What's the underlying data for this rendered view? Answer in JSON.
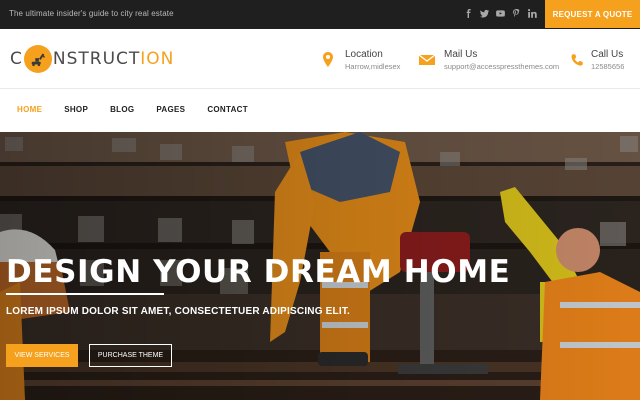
{
  "topbar": {
    "tagline": "The ultimate insider's guide to city real estate",
    "social_icons": [
      "facebook-icon",
      "twitter-icon",
      "youtube-icon",
      "pinterest-icon",
      "linkedin-icon"
    ],
    "cta_label": "REQUEST A QUOTE"
  },
  "header": {
    "logo": {
      "prefix": "C",
      "middle": "NSTRUCT",
      "accent": "ION"
    },
    "location": {
      "label": "Location",
      "value": "Harrow,midlesex"
    },
    "mail": {
      "label": "Mail Us",
      "value": "support@accesspressthemes.com"
    },
    "call": {
      "label": "Call Us",
      "value": "12585656"
    }
  },
  "nav": {
    "items": [
      {
        "label": "HOME",
        "active": true
      },
      {
        "label": "SHOP",
        "active": false
      },
      {
        "label": "BLOG",
        "active": false
      },
      {
        "label": "PAGES",
        "active": false
      },
      {
        "label": "CONTACT",
        "active": false
      }
    ]
  },
  "hero": {
    "title": "DESIGN YOUR DREAM HOME",
    "subtitle": "LOREM IPSUM DOLOR SIT AMET, CONSECTETUER ADIPISCING ELIT.",
    "primary_button": "VIEW SERVICES",
    "secondary_button": "PURCHASE THEME"
  },
  "colors": {
    "accent": "#f5a11d",
    "topbar_bg": "#1f1f1f",
    "text_dark": "#222222"
  }
}
